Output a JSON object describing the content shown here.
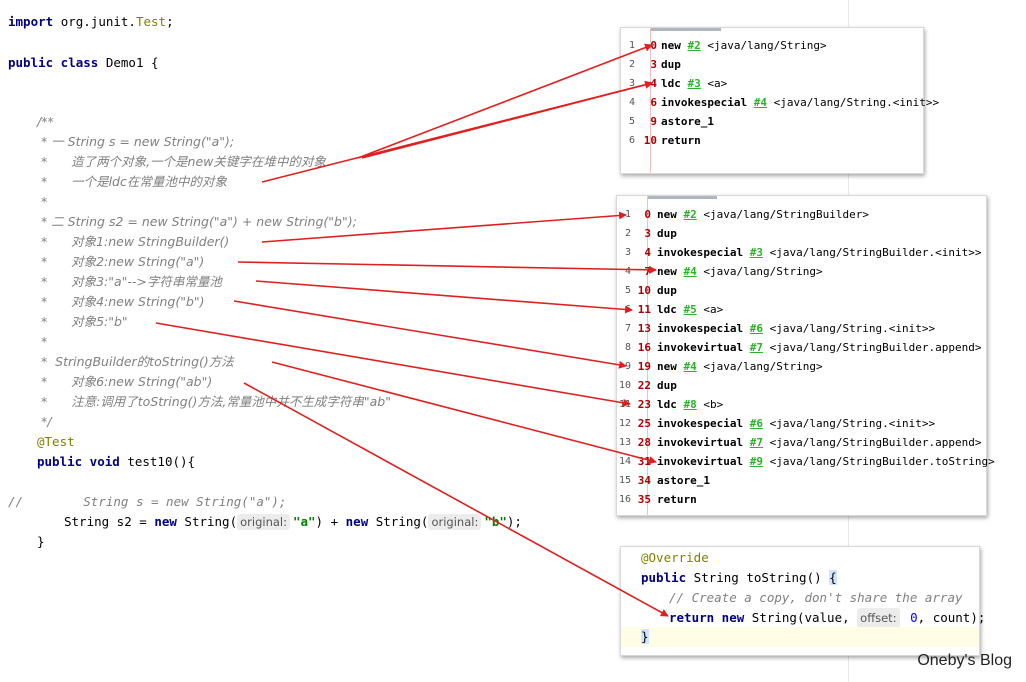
{
  "editor": {
    "import_kw": "import",
    "import_pkg": "org.junit.",
    "import_cls": "Test",
    "import_semi": ";",
    "class_decl_kw": "public class",
    "class_decl_name": " Demo1 {",
    "comments": [
      "/**",
      " * 一 String s = new String(\"a\");",
      " *      造了两个对象,一个是new关键字在堆中的对象",
      " *      一个是ldc在常量池中的对象",
      " *",
      " * 二 String s2 = new String(\"a\") + new String(\"b\");",
      " *      对象1:new StringBuilder()",
      " *      对象2:new String(\"a\")",
      " *      对象3:\"a\"-->字符串常量池",
      " *      对象4:new String(\"b\")",
      " *      对象5:\"b\"",
      " *",
      " *  StringBuilder的toString()方法",
      " *      对象6:new String(\"ab\")",
      " *      注意:调用了toString()方法,常量池中并不生成字符串\"ab\"",
      " */"
    ],
    "annotation": "@Test",
    "method_kw": "public void",
    "method_name": " test10(){",
    "commented_line_prefix": "//",
    "commented_line": "        String s = new String(\"a\");",
    "stmt_start": "String s2 = ",
    "stmt_new1": "new",
    "stmt_ctor1": " String(",
    "hint_label": "original:",
    "arg1": "\"a\"",
    "stmt_mid": ") + ",
    "stmt_new2": "new",
    "stmt_ctor2": " String(",
    "arg2": "\"b\"",
    "stmt_end": ");",
    "close_brace": "}"
  },
  "bytecode_panel_1": [
    {
      "line": "1",
      "offset": "0",
      "op": "new",
      "ref": "#2",
      "arg": "<java/lang/String>"
    },
    {
      "line": "2",
      "offset": "3",
      "op": "dup",
      "ref": "",
      "arg": ""
    },
    {
      "line": "3",
      "offset": "4",
      "op": "ldc",
      "ref": "#3",
      "arg": "<a>"
    },
    {
      "line": "4",
      "offset": "6",
      "op": "invokespecial",
      "ref": "#4",
      "arg": "<java/lang/String.<init>>"
    },
    {
      "line": "5",
      "offset": "9",
      "op": "astore_1",
      "ref": "",
      "arg": ""
    },
    {
      "line": "6",
      "offset": "10",
      "op": "return",
      "ref": "",
      "arg": ""
    }
  ],
  "bytecode_panel_2": [
    {
      "line": "1",
      "offset": "0",
      "op": "new",
      "ref": "#2",
      "arg": "<java/lang/StringBuilder>"
    },
    {
      "line": "2",
      "offset": "3",
      "op": "dup",
      "ref": "",
      "arg": ""
    },
    {
      "line": "3",
      "offset": "4",
      "op": "invokespecial",
      "ref": "#3",
      "arg": "<java/lang/StringBuilder.<init>>"
    },
    {
      "line": "4",
      "offset": "7",
      "op": "new",
      "ref": "#4",
      "arg": "<java/lang/String>"
    },
    {
      "line": "5",
      "offset": "10",
      "op": "dup",
      "ref": "",
      "arg": ""
    },
    {
      "line": "6",
      "offset": "11",
      "op": "ldc",
      "ref": "#5",
      "arg": "<a>"
    },
    {
      "line": "7",
      "offset": "13",
      "op": "invokespecial",
      "ref": "#6",
      "arg": "<java/lang/String.<init>>"
    },
    {
      "line": "8",
      "offset": "16",
      "op": "invokevirtual",
      "ref": "#7",
      "arg": "<java/lang/StringBuilder.append>"
    },
    {
      "line": "9",
      "offset": "19",
      "op": "new",
      "ref": "#4",
      "arg": "<java/lang/String>"
    },
    {
      "line": "10",
      "offset": "22",
      "op": "dup",
      "ref": "",
      "arg": ""
    },
    {
      "line": "11",
      "offset": "23",
      "op": "ldc",
      "ref": "#8",
      "arg": "<b>"
    },
    {
      "line": "12",
      "offset": "25",
      "op": "invokespecial",
      "ref": "#6",
      "arg": "<java/lang/String.<init>>"
    },
    {
      "line": "13",
      "offset": "28",
      "op": "invokevirtual",
      "ref": "#7",
      "arg": "<java/lang/StringBuilder.append>"
    },
    {
      "line": "14",
      "offset": "31",
      "op": "invokevirtual",
      "ref": "#9",
      "arg": "<java/lang/StringBuilder.toString>"
    },
    {
      "line": "15",
      "offset": "34",
      "op": "astore_1",
      "ref": "",
      "arg": ""
    },
    {
      "line": "16",
      "offset": "35",
      "op": "return",
      "ref": "",
      "arg": ""
    }
  ],
  "source_panel": {
    "annotation": "@Override",
    "decl_kw": "public",
    "decl_rest": " String toString() ",
    "brace_open": "{",
    "comment": "// Create a copy, don't share the array",
    "ret_kw": "return new",
    "ret_rest1": " String(value, ",
    "hint_label": "offset:",
    "hint_value": " 0",
    "ret_rest2": ", count);",
    "brace_close": "}"
  },
  "watermark": "Oneby's Blog",
  "colors": {
    "arrow": "#e02020",
    "keyword": "#000080",
    "comment": "#808080",
    "string": "#008000",
    "bytecode_ref": "#2ab32a"
  }
}
